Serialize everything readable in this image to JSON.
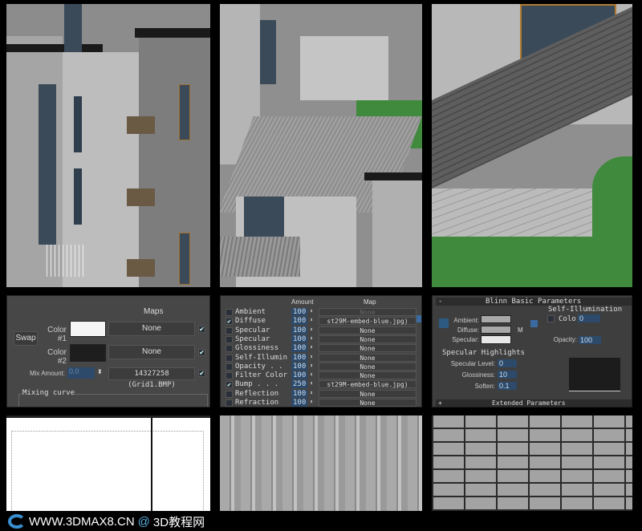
{
  "viewports": {
    "left": "perspective-building",
    "middle": "courtyard-roof",
    "right": "wall-lawn"
  },
  "mix_panel": {
    "maps_header": "Maps",
    "swap_label": "Swap",
    "color1_label": "Color #1",
    "color2_label": "Color #2",
    "color1": "#f5f5f5",
    "color2": "#1e1e1e",
    "map1": "None",
    "map2": "None",
    "mix_amount_label": "Mix Amount:",
    "mix_amount": "0.0",
    "mix_map": "14327258 (Grid1.BMP)",
    "mixing_curve_label": "Mixing curve"
  },
  "maps_panel": {
    "amount_header": "Amount",
    "map_header": "Map",
    "rows": [
      {
        "label": "Ambient",
        "checked": false,
        "amount": "100",
        "map": "None"
      },
      {
        "label": "Diffuse",
        "checked": true,
        "amount": "100",
        "map": "st29M-embed-blue.jpg)"
      },
      {
        "label": "Specular",
        "checked": false,
        "amount": "100",
        "map": "None"
      },
      {
        "label": "Specular",
        "checked": false,
        "amount": "100",
        "map": "None"
      },
      {
        "label": "Glossiness",
        "checked": false,
        "amount": "100",
        "map": "None"
      },
      {
        "label": "Self-Illumin",
        "checked": false,
        "amount": "100",
        "map": "None"
      },
      {
        "label": "Opacity . .",
        "checked": false,
        "amount": "100",
        "map": "None"
      },
      {
        "label": "Filter Color",
        "checked": false,
        "amount": "100",
        "map": "None"
      },
      {
        "label": "Bump . . .",
        "checked": true,
        "amount": "250",
        "map": "st29M-embed-blue.jpg)"
      },
      {
        "label": "Reflection",
        "checked": false,
        "amount": "100",
        "map": "None"
      },
      {
        "label": "Refraction",
        "checked": false,
        "amount": "100",
        "map": "None"
      }
    ]
  },
  "blinn_panel": {
    "title": "Blinn Basic Parameters",
    "collapse": "-",
    "ambient_label": "Ambient:",
    "diffuse_label": "Diffuse:",
    "specular_label": "Specular:",
    "ambient_color": "#a8a8a8",
    "diffuse_color": "#a8a8a8",
    "specular_color": "#e8e8e8",
    "m_button": "M",
    "self_illum_title": "Self-Illumination",
    "color_label": "Colo",
    "self_illum_value": "0",
    "opacity_label": "Opacity:",
    "opacity_value": "100",
    "spec_highlights_title": "Specular Highlights",
    "spec_level_label": "Specular Level:",
    "spec_level": "0",
    "glossiness_label": "Glossiness:",
    "glossiness": "10",
    "soften_label": "Soften:",
    "soften": "0.1",
    "extended_label": "Extended Parameters",
    "expand": "+"
  },
  "footer": {
    "site": "WWW.3DMAX8.CN",
    "at": "@",
    "name": "3D教程网"
  }
}
